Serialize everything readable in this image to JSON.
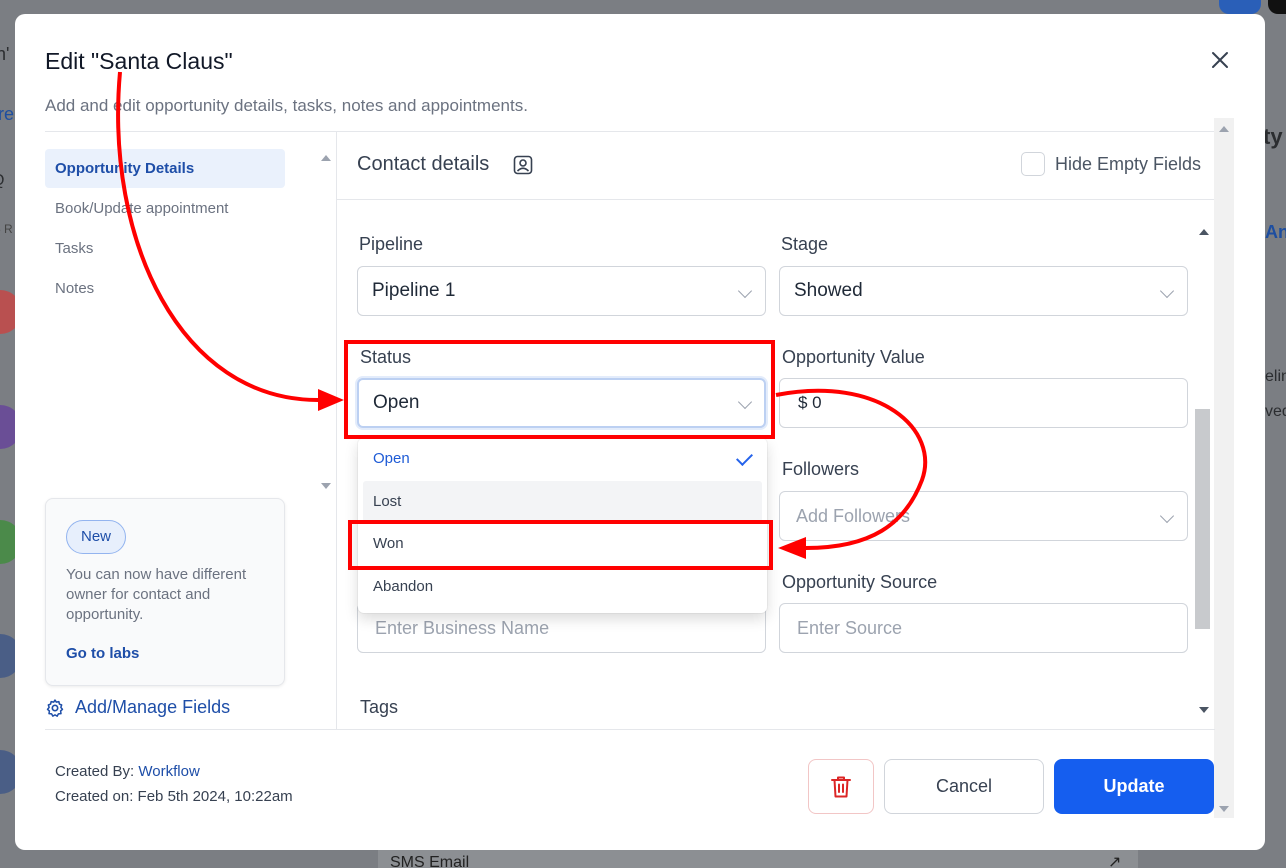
{
  "background": {
    "left_fragments": [
      "n'",
      "re",
      "Q",
      "5 R"
    ],
    "right_fragments": [
      "ty",
      "An",
      "elin",
      "ved"
    ],
    "bottom_bar": "SMS   Email",
    "bottom_arrow": "↗"
  },
  "modal": {
    "title": "Edit \"Santa Claus\"",
    "subtitle": "Add and edit opportunity details, tasks, notes and appointments."
  },
  "sidebar": {
    "items": [
      {
        "label": "Opportunity Details",
        "active": true
      },
      {
        "label": "Book/Update appointment",
        "active": false
      },
      {
        "label": "Tasks",
        "active": false
      },
      {
        "label": "Notes",
        "active": false
      }
    ],
    "promo": {
      "badge": "New",
      "text": "You can now have different owner for contact and opportunity.",
      "link": "Go to labs"
    },
    "manage_fields": "Add/Manage Fields"
  },
  "main": {
    "section_title": "Contact details",
    "hide_empty_label": "Hide Empty Fields",
    "pipeline": {
      "label": "Pipeline",
      "value": "Pipeline 1"
    },
    "stage": {
      "label": "Stage",
      "value": "Showed"
    },
    "status": {
      "label": "Status",
      "value": "Open",
      "options": [
        "Open",
        "Lost",
        "Won",
        "Abandon"
      ],
      "selected": "Open",
      "hovered": "Lost"
    },
    "opportunity_value": {
      "label": "Opportunity Value",
      "value": "$ 0"
    },
    "followers": {
      "label": "Followers",
      "placeholder": "Add Followers"
    },
    "business_name": {
      "placeholder": "Enter Business Name"
    },
    "opportunity_source": {
      "label": "Opportunity Source",
      "placeholder": "Enter Source"
    },
    "tags": {
      "label": "Tags"
    }
  },
  "footer": {
    "created_by_label": "Created By: ",
    "created_by_value": "Workflow",
    "created_on": "Created on: Feb 5th 2024, 10:22am",
    "cancel": "Cancel",
    "update": "Update"
  },
  "colors": {
    "primary": "#155eef",
    "link": "#1e4ea8",
    "annotation": "#ff0000"
  }
}
